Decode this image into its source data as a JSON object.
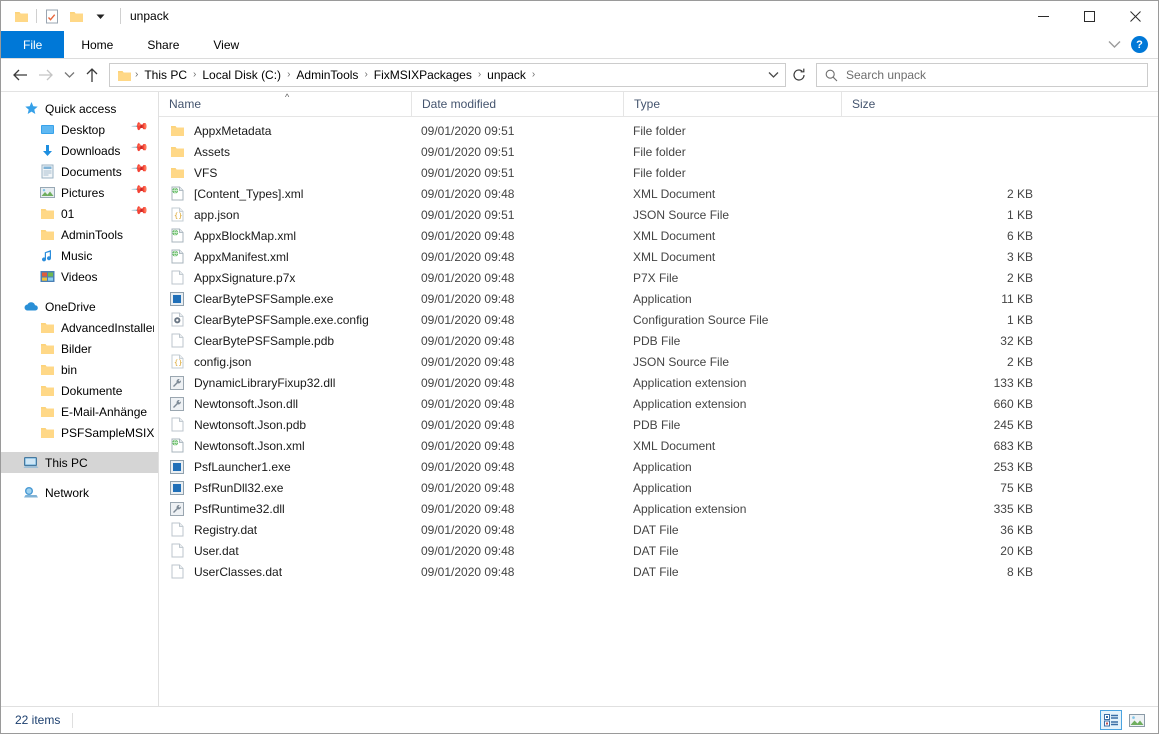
{
  "window": {
    "title": "unpack",
    "quick_access_toolbar": [
      {
        "name": "folder-icon",
        "label": "Explorer"
      },
      {
        "name": "properties-icon",
        "label": "Properties"
      },
      {
        "name": "new-folder-icon",
        "label": "New folder"
      },
      {
        "name": "chevron-down-icon",
        "label": "Customize Quick Access Toolbar"
      }
    ],
    "controls": {
      "minimize": "—",
      "maximize": "☐",
      "close": "✕"
    }
  },
  "ribbon": {
    "tabs": [
      {
        "label": "File",
        "active": true
      },
      {
        "label": "Home",
        "active": false
      },
      {
        "label": "Share",
        "active": false
      },
      {
        "label": "View",
        "active": false
      }
    ],
    "collapse_icon": "chevron-down-icon",
    "help_label": "?"
  },
  "address": {
    "back_icon": "arrow-left-icon",
    "forward_icon": "arrow-right-icon",
    "recent_icon": "chevron-down-icon",
    "up_icon": "arrow-up-icon",
    "breadcrumb": [
      "This PC",
      "Local Disk (C:)",
      "AdminTools",
      "FixMSIXPackages",
      "unpack"
    ],
    "separator": "›",
    "refresh_icon": "refresh-icon",
    "dropdown_icon": "chevron-down-icon"
  },
  "search": {
    "placeholder": "Search unpack",
    "icon": "search-icon"
  },
  "sidebar": {
    "groups": [
      {
        "header": {
          "label": "Quick access",
          "icon": "star-icon"
        },
        "items": [
          {
            "label": "Desktop",
            "icon": "desktop-icon",
            "pinned": true
          },
          {
            "label": "Downloads",
            "icon": "download-icon",
            "pinned": true
          },
          {
            "label": "Documents",
            "icon": "documents-icon",
            "pinned": true
          },
          {
            "label": "Pictures",
            "icon": "pictures-icon",
            "pinned": true
          },
          {
            "label": "01",
            "icon": "folder-icon",
            "pinned": true
          },
          {
            "label": "AdminTools",
            "icon": "folder-icon",
            "pinned": false
          },
          {
            "label": "Music",
            "icon": "music-icon",
            "pinned": false
          },
          {
            "label": "Videos",
            "icon": "videos-icon",
            "pinned": false
          }
        ]
      },
      {
        "header": {
          "label": "OneDrive",
          "icon": "cloud-icon"
        },
        "items": [
          {
            "label": "AdvancedInstallerC",
            "icon": "folder-icon",
            "pinned": false
          },
          {
            "label": "Bilder",
            "icon": "folder-icon",
            "pinned": false
          },
          {
            "label": "bin",
            "icon": "folder-icon",
            "pinned": false
          },
          {
            "label": "Dokumente",
            "icon": "folder-icon",
            "pinned": false
          },
          {
            "label": "E-Mail-Anhänge",
            "icon": "folder-icon",
            "pinned": false
          },
          {
            "label": "PSFSampleMSIXRoo",
            "icon": "folder-icon",
            "pinned": false
          }
        ]
      },
      {
        "header": {
          "label": "This PC",
          "icon": "thispc-icon",
          "selected": true
        },
        "items": []
      },
      {
        "header": {
          "label": "Network",
          "icon": "network-icon"
        },
        "items": []
      }
    ]
  },
  "columns": [
    {
      "label": "Name",
      "sorted": "asc"
    },
    {
      "label": "Date modified",
      "sorted": ""
    },
    {
      "label": "Type",
      "sorted": ""
    },
    {
      "label": "Size",
      "sorted": ""
    }
  ],
  "files": [
    {
      "name": "AppxMetadata",
      "date": "09/01/2020 09:51",
      "type": "File folder",
      "size": "",
      "icon": "folder-icon"
    },
    {
      "name": "Assets",
      "date": "09/01/2020 09:51",
      "type": "File folder",
      "size": "",
      "icon": "folder-icon"
    },
    {
      "name": "VFS",
      "date": "09/01/2020 09:51",
      "type": "File folder",
      "size": "",
      "icon": "folder-icon"
    },
    {
      "name": "[Content_Types].xml",
      "date": "09/01/2020 09:48",
      "type": "XML Document",
      "size": "2 KB",
      "icon": "xml-file-icon"
    },
    {
      "name": "app.json",
      "date": "09/01/2020 09:51",
      "type": "JSON Source File",
      "size": "1 KB",
      "icon": "json-file-icon"
    },
    {
      "name": "AppxBlockMap.xml",
      "date": "09/01/2020 09:48",
      "type": "XML Document",
      "size": "6 KB",
      "icon": "xml-file-icon"
    },
    {
      "name": "AppxManifest.xml",
      "date": "09/01/2020 09:48",
      "type": "XML Document",
      "size": "3 KB",
      "icon": "xml-file-icon"
    },
    {
      "name": "AppxSignature.p7x",
      "date": "09/01/2020 09:48",
      "type": "P7X File",
      "size": "2 KB",
      "icon": "generic-file-icon"
    },
    {
      "name": "ClearBytePSFSample.exe",
      "date": "09/01/2020 09:48",
      "type": "Application",
      "size": "11 KB",
      "icon": "exe-file-icon"
    },
    {
      "name": "ClearBytePSFSample.exe.config",
      "date": "09/01/2020 09:48",
      "type": "Configuration Source File",
      "size": "1 KB",
      "icon": "config-file-icon"
    },
    {
      "name": "ClearBytePSFSample.pdb",
      "date": "09/01/2020 09:48",
      "type": "PDB File",
      "size": "32 KB",
      "icon": "generic-file-icon"
    },
    {
      "name": "config.json",
      "date": "09/01/2020 09:48",
      "type": "JSON Source File",
      "size": "2 KB",
      "icon": "json-file-icon"
    },
    {
      "name": "DynamicLibraryFixup32.dll",
      "date": "09/01/2020 09:48",
      "type": "Application extension",
      "size": "133 KB",
      "icon": "dll-file-icon"
    },
    {
      "name": "Newtonsoft.Json.dll",
      "date": "09/01/2020 09:48",
      "type": "Application extension",
      "size": "660 KB",
      "icon": "dll-file-icon"
    },
    {
      "name": "Newtonsoft.Json.pdb",
      "date": "09/01/2020 09:48",
      "type": "PDB File",
      "size": "245 KB",
      "icon": "generic-file-icon"
    },
    {
      "name": "Newtonsoft.Json.xml",
      "date": "09/01/2020 09:48",
      "type": "XML Document",
      "size": "683 KB",
      "icon": "xml-file-icon"
    },
    {
      "name": "PsfLauncher1.exe",
      "date": "09/01/2020 09:48",
      "type": "Application",
      "size": "253 KB",
      "icon": "exe-file-icon"
    },
    {
      "name": "PsfRunDll32.exe",
      "date": "09/01/2020 09:48",
      "type": "Application",
      "size": "75 KB",
      "icon": "exe-file-icon"
    },
    {
      "name": "PsfRuntime32.dll",
      "date": "09/01/2020 09:48",
      "type": "Application extension",
      "size": "335 KB",
      "icon": "dll-file-icon"
    },
    {
      "name": "Registry.dat",
      "date": "09/01/2020 09:48",
      "type": "DAT File",
      "size": "36 KB",
      "icon": "generic-file-icon"
    },
    {
      "name": "User.dat",
      "date": "09/01/2020 09:48",
      "type": "DAT File",
      "size": "20 KB",
      "icon": "generic-file-icon"
    },
    {
      "name": "UserClasses.dat",
      "date": "09/01/2020 09:48",
      "type": "DAT File",
      "size": "8 KB",
      "icon": "generic-file-icon"
    }
  ],
  "statusbar": {
    "item_count": "22 items",
    "views": [
      {
        "name": "details-view-button",
        "active": true
      },
      {
        "name": "large-icons-view-button",
        "active": false
      }
    ]
  },
  "colors": {
    "accent": "#0078d7",
    "folder": "#ffd075",
    "header_text": "#44546e",
    "status_text": "#1c3f6e"
  }
}
